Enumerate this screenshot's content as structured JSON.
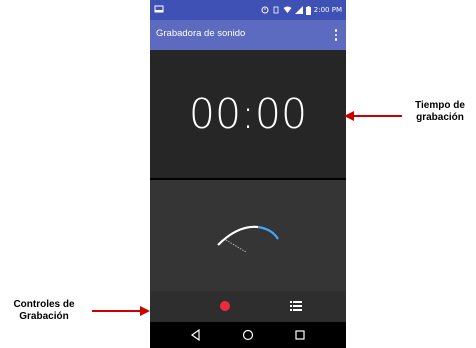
{
  "status_bar": {
    "time": "2:00 PM",
    "icons": [
      "media-icon",
      "alarm-icon",
      "wifi-icon",
      "signal-icon",
      "battery-icon"
    ]
  },
  "app_bar": {
    "title": "Grabadora de sonido",
    "menu_icon": "overflow-menu-icon"
  },
  "timer": {
    "value": "00:00"
  },
  "controls": {
    "record_icon": "record-icon",
    "list_icon": "recordings-list-icon"
  },
  "nav_bar": {
    "icons": [
      "back-icon",
      "home-icon",
      "recents-icon"
    ]
  },
  "annotations": {
    "timer_label_line1": "Tiempo de",
    "timer_label_line2": "grabación",
    "controls_label_line1": "Controles de",
    "controls_label_line2": "Grabación"
  },
  "colors": {
    "status_bar": "#3f51b5",
    "app_bar": "#5c6bc0",
    "record": "#f02a3d",
    "arrow": "#cc0000",
    "meter_arc": "#42a5f5"
  }
}
